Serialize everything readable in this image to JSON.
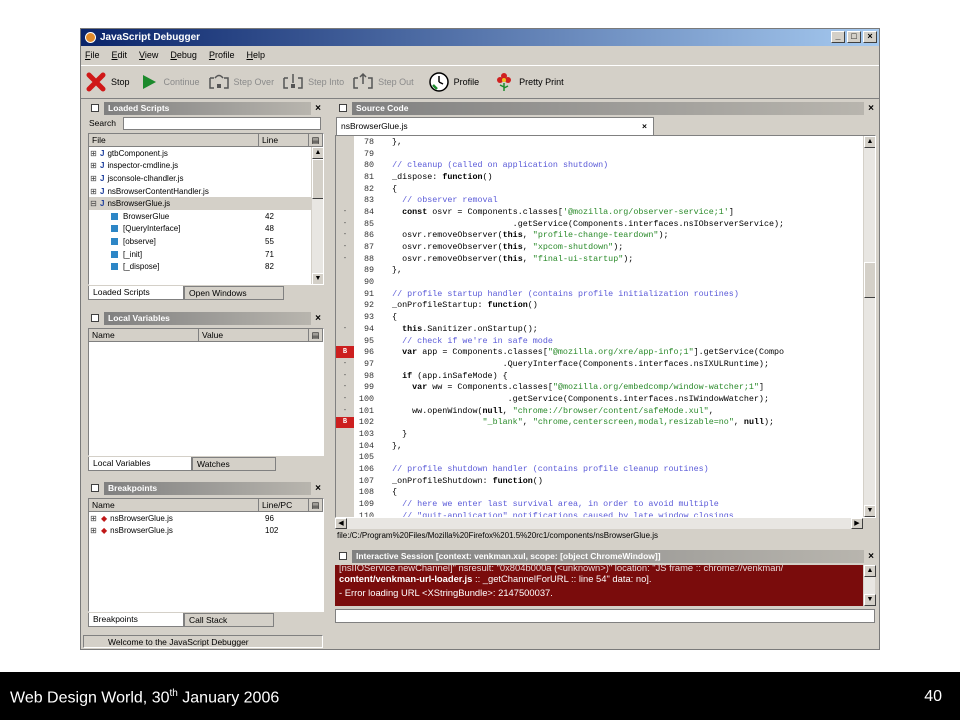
{
  "window": {
    "title": "JavaScript Debugger"
  },
  "menu": [
    "File",
    "Edit",
    "View",
    "Debug",
    "Profile",
    "Help"
  ],
  "toolbar": {
    "stop": "Stop",
    "continue": "Continue",
    "step_over": "Step Over",
    "step_into": "Step Into",
    "step_out": "Step Out",
    "profile": "Profile",
    "pretty_print": "Pretty Print"
  },
  "loaded_scripts": {
    "title": "Loaded Scripts",
    "search_label": "Search",
    "search_value": "",
    "col_file": "File",
    "col_line": "Line",
    "files": [
      "gtbComponent.js",
      "inspector-cmdline.js",
      "jsconsole-clhandler.js",
      "nsBrowserContentHandler.js",
      "nsBrowserGlue.js"
    ],
    "functions": [
      {
        "name": "BrowserGlue",
        "line": "42"
      },
      {
        "name": "[QueryInterface]",
        "line": "48"
      },
      {
        "name": "[observe]",
        "line": "55"
      },
      {
        "name": "[_init]",
        "line": "71"
      },
      {
        "name": "[_dispose]",
        "line": "82"
      }
    ],
    "tab_scripts": "Loaded Scripts",
    "tab_windows": "Open Windows"
  },
  "local_variables": {
    "title": "Local Variables",
    "col_name": "Name",
    "col_value": "Value",
    "tab_locals": "Local Variables",
    "tab_watches": "Watches"
  },
  "breakpoints": {
    "title": "Breakpoints",
    "col_name": "Name",
    "col_line": "Line/PC",
    "items": [
      {
        "name": "nsBrowserGlue.js",
        "line": "96"
      },
      {
        "name": "nsBrowserGlue.js",
        "line": "102"
      }
    ],
    "tab_breakpoints": "Breakpoints",
    "tab_callstack": "Call Stack"
  },
  "source": {
    "title": "Source Code",
    "tab": "nsBrowserGlue.js",
    "path": "file:/C:/Program%20Files/Mozilla%20Firefox%201.5%20rc1/components/nsBrowserGlue.js",
    "lines": [
      {
        "n": "78",
        "g": "",
        "t": "  },"
      },
      {
        "n": "79",
        "g": "",
        "t": ""
      },
      {
        "n": "80",
        "g": "",
        "t": "  // cleanup (called on application shutdown)"
      },
      {
        "n": "81",
        "g": "",
        "t": "  _dispose: function()"
      },
      {
        "n": "82",
        "g": "",
        "t": "  {"
      },
      {
        "n": "83",
        "g": "",
        "t": "    // observer removal"
      },
      {
        "n": "84",
        "g": "-",
        "t": "    const osvr = Components.classes['@mozilla.org/observer-service;1']"
      },
      {
        "n": "85",
        "g": "-",
        "t": "                          .getService(Components.interfaces.nsIObserverService);"
      },
      {
        "n": "86",
        "g": "-",
        "t": "    osvr.removeObserver(this, \"profile-change-teardown\");"
      },
      {
        "n": "87",
        "g": "-",
        "t": "    osvr.removeObserver(this, \"xpcom-shutdown\");"
      },
      {
        "n": "88",
        "g": "-",
        "t": "    osvr.removeObserver(this, \"final-ui-startup\");"
      },
      {
        "n": "89",
        "g": "",
        "t": "  },"
      },
      {
        "n": "90",
        "g": "",
        "t": ""
      },
      {
        "n": "91",
        "g": "",
        "t": "  // profile startup handler (contains profile initialization routines)"
      },
      {
        "n": "92",
        "g": "",
        "t": "  _onProfileStartup: function()"
      },
      {
        "n": "93",
        "g": "",
        "t": "  {"
      },
      {
        "n": "94",
        "g": "-",
        "t": "    this.Sanitizer.onStartup();"
      },
      {
        "n": "95",
        "g": "",
        "t": "    // check if we're in safe mode"
      },
      {
        "n": "96",
        "g": "B",
        "t": "    var app = Components.classes[\"@mozilla.org/xre/app-info;1\"].getService(Compo"
      },
      {
        "n": "97",
        "g": "-",
        "t": "                        .QueryInterface(Components.interfaces.nsIXULRuntime);"
      },
      {
        "n": "98",
        "g": "-",
        "t": "    if (app.inSafeMode) {"
      },
      {
        "n": "99",
        "g": "-",
        "t": "      var ww = Components.classes[\"@mozilla.org/embedcomp/window-watcher;1\"]"
      },
      {
        "n": "100",
        "g": "-",
        "t": "                         .getService(Components.interfaces.nsIWindowWatcher);"
      },
      {
        "n": "101",
        "g": "-",
        "t": "      ww.openWindow(null, \"chrome://browser/content/safeMode.xul\","
      },
      {
        "n": "102",
        "g": "B",
        "t": "                    \"_blank\", \"chrome,centerscreen,modal,resizable=no\", null);"
      },
      {
        "n": "103",
        "g": "",
        "t": "    }"
      },
      {
        "n": "104",
        "g": "",
        "t": "  },"
      },
      {
        "n": "105",
        "g": "",
        "t": ""
      },
      {
        "n": "106",
        "g": "",
        "t": "  // profile shutdown handler (contains profile cleanup routines)"
      },
      {
        "n": "107",
        "g": "",
        "t": "  _onProfileShutdown: function()"
      },
      {
        "n": "108",
        "g": "",
        "t": "  {"
      },
      {
        "n": "109",
        "g": "",
        "t": "    // here we enter last survival area, in order to avoid multiple"
      },
      {
        "n": "110",
        "g": "",
        "t": "    // \"quit-application\" notifications caused by late window closings"
      }
    ]
  },
  "interactive": {
    "title": "Interactive Session [context: venkman.xul, scope: [object ChromeWindow]]",
    "line1": "[nsIIOService.newChannel]\"  nsresult: \"0x804b000a (<unknown>)\"  location: \"JS frame :: chrome://venkman/",
    "line2_bold": "content/venkman-url-loader.js",
    "line2_rest": " :: _getChannelForURL :: line 54\"  data: no].",
    "line3": "- Error loading URL <XStringBundle>: 2147500037.",
    "input_value": ""
  },
  "status": "Welcome to the JavaScript Debugger",
  "slide_footer": {
    "left_main": "Web Design World, 30",
    "left_sup": "th",
    "left_tail": " January 2006",
    "page": "40"
  }
}
